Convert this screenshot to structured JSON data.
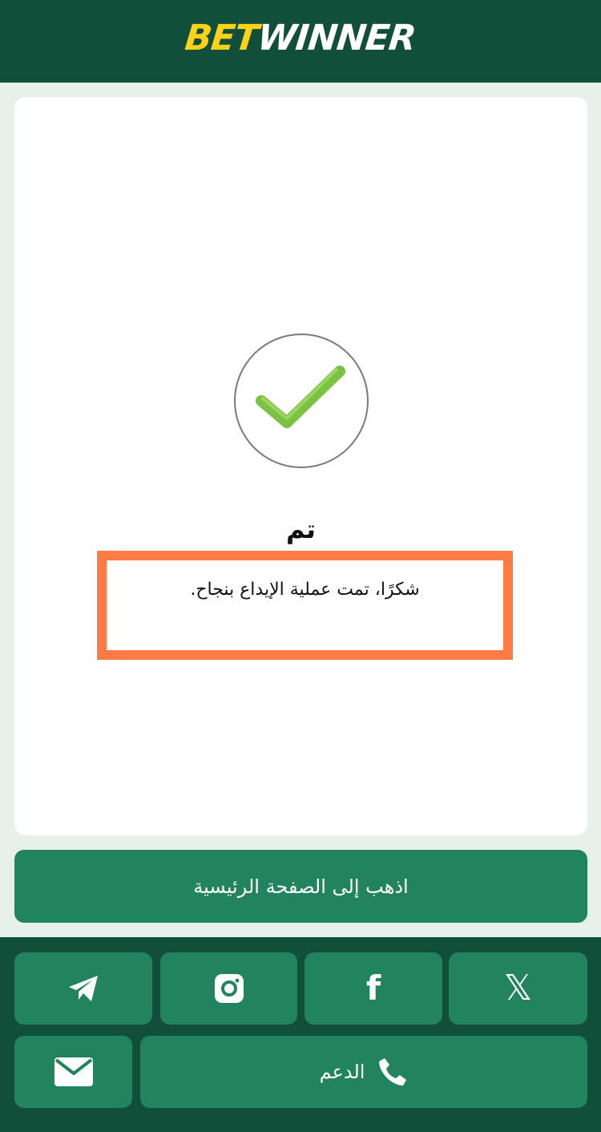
{
  "header": {
    "logo_part1": "BET",
    "logo_part2": "WINNER",
    "background": "#124f3a",
    "logo_accent": "#ffd21a"
  },
  "status": {
    "icon": "check-icon",
    "title": "تم",
    "message": "شكرًا، تمت عملية الإيداع بنجاح.",
    "highlight_color": "#ff7b45"
  },
  "home_button": {
    "label": "اذهب إلى الصفحة الرئيسية",
    "color": "#21845e"
  },
  "footer": {
    "social": [
      {
        "name": "telegram",
        "icon": "telegram-icon"
      },
      {
        "name": "instagram",
        "icon": "instagram-icon"
      },
      {
        "name": "facebook",
        "icon": "facebook-icon",
        "glyph": "f"
      },
      {
        "name": "x",
        "icon": "x-icon",
        "glyph": "𝕏"
      }
    ],
    "email_icon": "mail-icon",
    "support": {
      "label": "الدعم",
      "icon": "phone-icon"
    }
  }
}
